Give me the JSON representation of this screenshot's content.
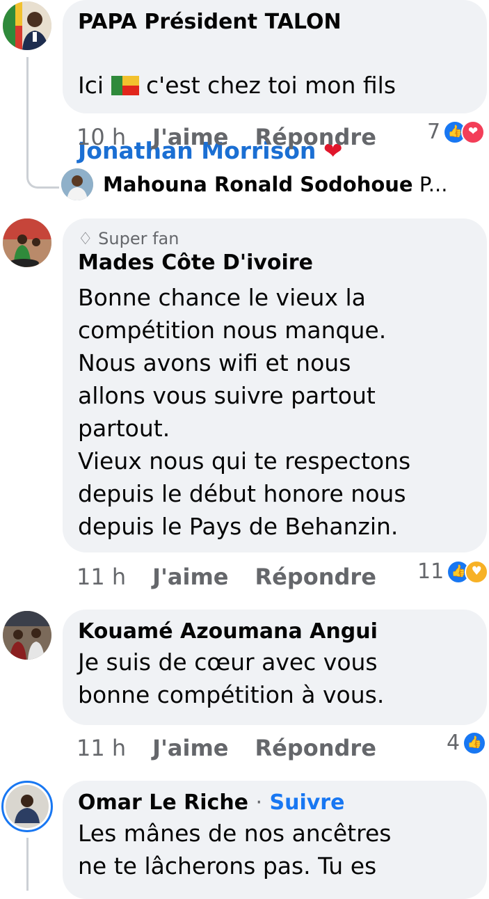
{
  "comments": [
    {
      "author": "PAPA Président TALON",
      "text_prefix": "Ici ",
      "flag_icon": "benin-flag",
      "text_suffix": " c'est chez toi mon fils",
      "mention": "Jonathan Morrison",
      "heart": "❤️",
      "time": "10 h",
      "like": "J'aime",
      "reply": "Répondre",
      "reaction_count": "7",
      "reactions": [
        "like",
        "love"
      ]
    },
    {
      "reply_author": "Mahouna Ronald Sodohoue",
      "reply_suffix": "P..."
    },
    {
      "badge": "Super fan",
      "author": "Mades Côte D'ivoire",
      "text": "Bonne chance le vieux la\ncompétition nous manque.\nNous avons wifi et nous\nallons vous suivre partout\npartout.\nVieux nous qui te respectons\ndepuis le début honore nous\ndepuis le Pays de Behanzin.",
      "time": "11 h",
      "like": "J'aime",
      "reply": "Répondre",
      "reaction_count": "11",
      "reactions": [
        "like",
        "care"
      ]
    },
    {
      "author": "Kouamé Azoumana Angui",
      "text": "Je suis de cœur avec vous\nbonne compétition à vous.",
      "time": "11 h",
      "like": "J'aime",
      "reply": "Répondre",
      "reaction_count": "4",
      "reactions": [
        "like"
      ]
    },
    {
      "author": "Omar Le Riche",
      "separator": "·",
      "follow": "Suivre",
      "text": "Les mânes de nos ancêtres\nne te lâcherons pas. Tu es"
    }
  ],
  "colors": {
    "bubble": "#f0f2f5",
    "link": "#1b6fd3",
    "meta": "#65676b",
    "like": "#1877f2",
    "love": "#f33e58",
    "care": "#f7b125"
  }
}
